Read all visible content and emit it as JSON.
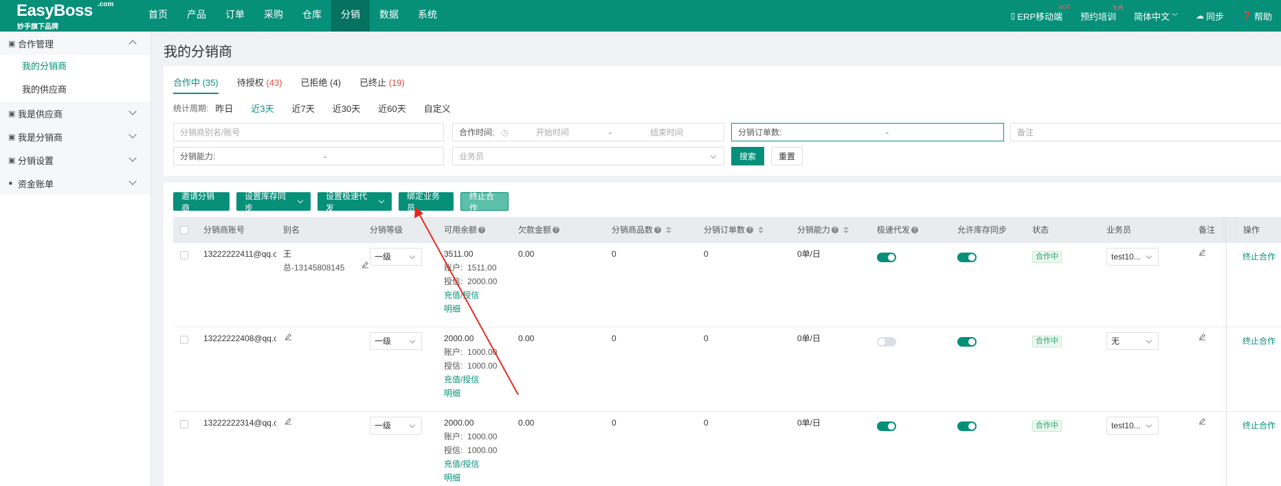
{
  "app": {
    "brand": "EasyBoss",
    "brand_suffix": ".com",
    "brand_sub": "妙手旗下品牌"
  },
  "nav": [
    "首页",
    "产品",
    "订单",
    "采购",
    "仓库",
    "分销",
    "数据",
    "系统"
  ],
  "top_right": {
    "mobile": "ERP移动端",
    "mobile_sup": "HOT",
    "training": "预约培训",
    "training_sup": "免费",
    "language": "简体中文",
    "sync": "同步",
    "help": "帮助"
  },
  "sidebar": {
    "group1": "合作管理",
    "sub1": "我的分销商",
    "sub2": "我的供应商",
    "group2": "我是供应商",
    "group3": "我是分销商",
    "group4": "分销设置",
    "group5": "资金账单"
  },
  "page_title": "我的分销商",
  "tabs": [
    {
      "label": "合作中",
      "count": "(35)"
    },
    {
      "label": "待授权",
      "count": "(43)"
    },
    {
      "label": "已拒绝",
      "count": "(4)"
    },
    {
      "label": "已终止",
      "count": "(19)"
    }
  ],
  "period": {
    "label": "统计周期:",
    "options": [
      "昨日",
      "近3天",
      "近7天",
      "近30天",
      "近60天",
      "自定义"
    ]
  },
  "filters": {
    "account_placeholder": "分销商别名/账号",
    "coop_time_label": "合作时间:",
    "start_placeholder": "开始时间",
    "end_placeholder": "结束时间",
    "order_count_label": "分销订单数:",
    "remark_placeholder": "备注",
    "capacity_label": "分销能力:",
    "salesman_placeholder": "业务员",
    "dash": "-",
    "search": "搜索",
    "reset": "重置"
  },
  "actions": {
    "invite": "邀请分销商",
    "stock_sync": "设置库存同步",
    "fast_ship": "设置极速代发",
    "bind_salesman": "绑定业务员",
    "terminate": "终止合作"
  },
  "columns": {
    "account": "分销商账号",
    "alias": "别名",
    "level": "分销等级",
    "balance": "可用余额",
    "debt": "欠款金额",
    "product_count": "分销商品数",
    "order_count": "分销订单数",
    "capacity": "分销能力",
    "fast_ship": "极速代发",
    "stock_sync": "允许库存同步",
    "status": "状态",
    "salesman": "业务员",
    "remark": "备注",
    "operation": "操作"
  },
  "labels": {
    "account_prefix": "账户:",
    "credit_prefix": "授信:",
    "recharge": "充值/授信",
    "detail": "明细"
  },
  "rows": [
    {
      "account": "13222222411@qq.c",
      "alias": "王",
      "alias_sub": "总-13145808145",
      "level": "一级",
      "balance": "3511.00",
      "acct": "1511.00",
      "credit": "2000.00",
      "debt": "0.00",
      "products": "0",
      "orders": "0",
      "capacity": "0单/日",
      "fast_ship": true,
      "stock_sync": true,
      "status": "合作中",
      "salesman": "test10...",
      "op": "终止合作"
    },
    {
      "account": "13222222408@qq.c",
      "alias": "",
      "alias_sub": "",
      "level": "一级",
      "balance": "2000.00",
      "acct": "1000.00",
      "credit": "1000.00",
      "debt": "0.00",
      "products": "0",
      "orders": "0",
      "capacity": "0单/日",
      "fast_ship": false,
      "stock_sync": true,
      "status": "合作中",
      "salesman": "无",
      "op": "终止合作"
    },
    {
      "account": "13222222314@qq.c",
      "alias": "",
      "alias_sub": "",
      "level": "一级",
      "balance": "2000.00",
      "acct": "1000.00",
      "credit": "1000.00",
      "debt": "0.00",
      "products": "0",
      "orders": "0",
      "capacity": "0单/日",
      "fast_ship": true,
      "stock_sync": true,
      "status": "合作中",
      "salesman": "test10...",
      "op": "终止合作"
    }
  ],
  "colors": {
    "primary": "#068f79",
    "annotation_arrow": "#e5281f"
  }
}
